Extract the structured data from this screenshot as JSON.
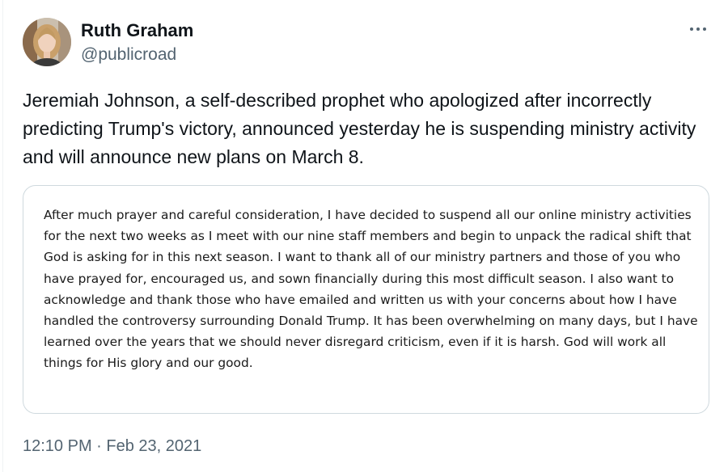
{
  "author": {
    "display_name": "Ruth Graham",
    "handle": "@publicroad",
    "avatar_icon": "profile-photo"
  },
  "more_icon": "more-horizontal-icon",
  "tweet": {
    "text": "Jeremiah Johnson, a self-described prophet who apologized after incorrectly predicting Trump's victory, announced yesterday he is suspending ministry activity and will announce new plans on March 8.",
    "timestamp": "12:10 PM · Feb 23, 2021"
  },
  "media": {
    "statement_text": "After much prayer and careful consideration, I have decided to suspend all our online ministry activities for the next two weeks as I meet with our nine staff members and begin to unpack the radical shift that God is asking for in this next season. I want to thank all of our ministry partners and those of you who have prayed for, encouraged us, and sown financially during this most difficult season. I also want to acknowledge and thank those who have emailed and written us with your concerns about how I have handled the controversy surrounding Donald Trump. It has been overwhelming on many days, but I have learned over the years that we should never disregard criticism, even if it is harsh. God will work all things for His glory and our good."
  },
  "colors": {
    "text_primary": "#0f1419",
    "text_secondary": "#536471",
    "border": "#cfd9de"
  }
}
